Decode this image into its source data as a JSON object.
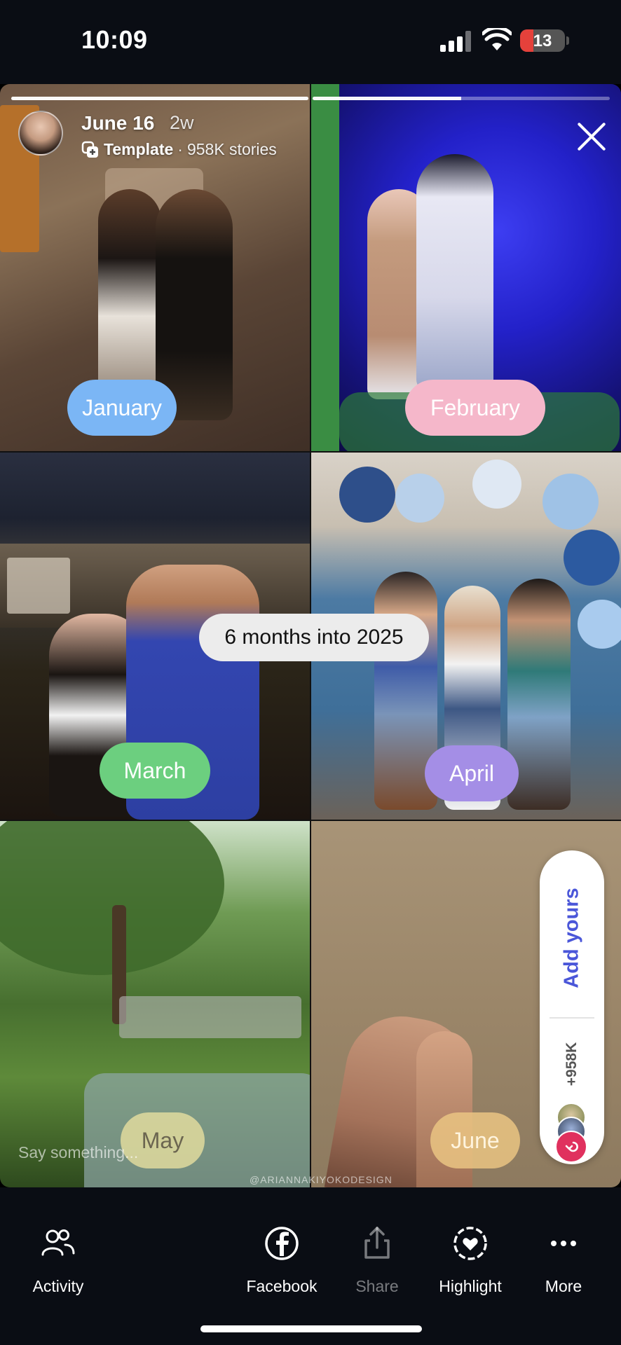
{
  "status_bar": {
    "time": "10:09",
    "battery_level": "13",
    "icons": [
      "signal-icon",
      "wifi-icon",
      "battery-icon"
    ]
  },
  "story": {
    "header": {
      "username": "June 16",
      "time_ago": "2w",
      "template_label": "Template",
      "separator": "·",
      "template_count": "958K stories"
    },
    "progress": [
      1.0,
      0.5
    ],
    "caption": "6 months into 2025",
    "months": [
      "January",
      "February",
      "March",
      "April",
      "May",
      "June"
    ],
    "reply_placeholder": "Say something...",
    "watermark": "@ARIANNAKIYOKODESIGN",
    "add_yours": {
      "label": "Add yours",
      "count": "+958K"
    }
  },
  "actions": [
    {
      "label": "Activity",
      "icon": "activity-icon"
    },
    {
      "label": "Facebook",
      "icon": "facebook-icon"
    },
    {
      "label": "Share",
      "icon": "share-icon"
    },
    {
      "label": "Highlight",
      "icon": "highlight-icon"
    },
    {
      "label": "More",
      "icon": "more-icon"
    }
  ],
  "colors": {
    "january": "#7bb6f5",
    "february": "#f5b7ca",
    "march": "#6ccf7f",
    "april": "#a48ee6",
    "add_yours_text": "#4a56d9",
    "battery_low": "#e5413b"
  }
}
